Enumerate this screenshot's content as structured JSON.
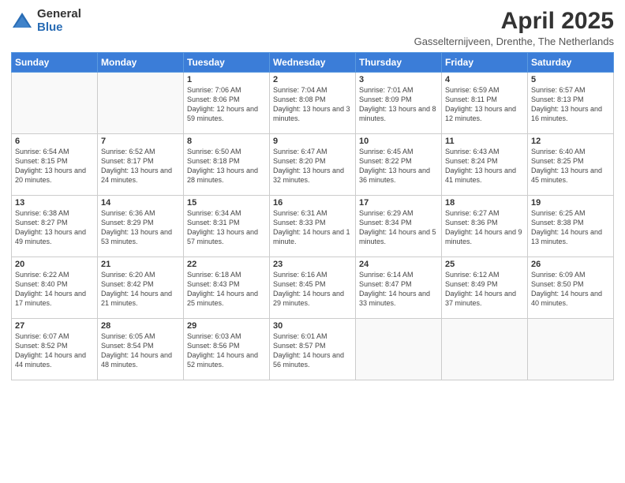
{
  "logo": {
    "general": "General",
    "blue": "Blue"
  },
  "header": {
    "title": "April 2025",
    "subtitle": "Gasselternijveen, Drenthe, The Netherlands"
  },
  "days_of_week": [
    "Sunday",
    "Monday",
    "Tuesday",
    "Wednesday",
    "Thursday",
    "Friday",
    "Saturday"
  ],
  "weeks": [
    [
      {
        "day": "",
        "info": ""
      },
      {
        "day": "",
        "info": ""
      },
      {
        "day": "1",
        "info": "Sunrise: 7:06 AM\nSunset: 8:06 PM\nDaylight: 12 hours and 59 minutes."
      },
      {
        "day": "2",
        "info": "Sunrise: 7:04 AM\nSunset: 8:08 PM\nDaylight: 13 hours and 3 minutes."
      },
      {
        "day": "3",
        "info": "Sunrise: 7:01 AM\nSunset: 8:09 PM\nDaylight: 13 hours and 8 minutes."
      },
      {
        "day": "4",
        "info": "Sunrise: 6:59 AM\nSunset: 8:11 PM\nDaylight: 13 hours and 12 minutes."
      },
      {
        "day": "5",
        "info": "Sunrise: 6:57 AM\nSunset: 8:13 PM\nDaylight: 13 hours and 16 minutes."
      }
    ],
    [
      {
        "day": "6",
        "info": "Sunrise: 6:54 AM\nSunset: 8:15 PM\nDaylight: 13 hours and 20 minutes."
      },
      {
        "day": "7",
        "info": "Sunrise: 6:52 AM\nSunset: 8:17 PM\nDaylight: 13 hours and 24 minutes."
      },
      {
        "day": "8",
        "info": "Sunrise: 6:50 AM\nSunset: 8:18 PM\nDaylight: 13 hours and 28 minutes."
      },
      {
        "day": "9",
        "info": "Sunrise: 6:47 AM\nSunset: 8:20 PM\nDaylight: 13 hours and 32 minutes."
      },
      {
        "day": "10",
        "info": "Sunrise: 6:45 AM\nSunset: 8:22 PM\nDaylight: 13 hours and 36 minutes."
      },
      {
        "day": "11",
        "info": "Sunrise: 6:43 AM\nSunset: 8:24 PM\nDaylight: 13 hours and 41 minutes."
      },
      {
        "day": "12",
        "info": "Sunrise: 6:40 AM\nSunset: 8:25 PM\nDaylight: 13 hours and 45 minutes."
      }
    ],
    [
      {
        "day": "13",
        "info": "Sunrise: 6:38 AM\nSunset: 8:27 PM\nDaylight: 13 hours and 49 minutes."
      },
      {
        "day": "14",
        "info": "Sunrise: 6:36 AM\nSunset: 8:29 PM\nDaylight: 13 hours and 53 minutes."
      },
      {
        "day": "15",
        "info": "Sunrise: 6:34 AM\nSunset: 8:31 PM\nDaylight: 13 hours and 57 minutes."
      },
      {
        "day": "16",
        "info": "Sunrise: 6:31 AM\nSunset: 8:33 PM\nDaylight: 14 hours and 1 minute."
      },
      {
        "day": "17",
        "info": "Sunrise: 6:29 AM\nSunset: 8:34 PM\nDaylight: 14 hours and 5 minutes."
      },
      {
        "day": "18",
        "info": "Sunrise: 6:27 AM\nSunset: 8:36 PM\nDaylight: 14 hours and 9 minutes."
      },
      {
        "day": "19",
        "info": "Sunrise: 6:25 AM\nSunset: 8:38 PM\nDaylight: 14 hours and 13 minutes."
      }
    ],
    [
      {
        "day": "20",
        "info": "Sunrise: 6:22 AM\nSunset: 8:40 PM\nDaylight: 14 hours and 17 minutes."
      },
      {
        "day": "21",
        "info": "Sunrise: 6:20 AM\nSunset: 8:42 PM\nDaylight: 14 hours and 21 minutes."
      },
      {
        "day": "22",
        "info": "Sunrise: 6:18 AM\nSunset: 8:43 PM\nDaylight: 14 hours and 25 minutes."
      },
      {
        "day": "23",
        "info": "Sunrise: 6:16 AM\nSunset: 8:45 PM\nDaylight: 14 hours and 29 minutes."
      },
      {
        "day": "24",
        "info": "Sunrise: 6:14 AM\nSunset: 8:47 PM\nDaylight: 14 hours and 33 minutes."
      },
      {
        "day": "25",
        "info": "Sunrise: 6:12 AM\nSunset: 8:49 PM\nDaylight: 14 hours and 37 minutes."
      },
      {
        "day": "26",
        "info": "Sunrise: 6:09 AM\nSunset: 8:50 PM\nDaylight: 14 hours and 40 minutes."
      }
    ],
    [
      {
        "day": "27",
        "info": "Sunrise: 6:07 AM\nSunset: 8:52 PM\nDaylight: 14 hours and 44 minutes."
      },
      {
        "day": "28",
        "info": "Sunrise: 6:05 AM\nSunset: 8:54 PM\nDaylight: 14 hours and 48 minutes."
      },
      {
        "day": "29",
        "info": "Sunrise: 6:03 AM\nSunset: 8:56 PM\nDaylight: 14 hours and 52 minutes."
      },
      {
        "day": "30",
        "info": "Sunrise: 6:01 AM\nSunset: 8:57 PM\nDaylight: 14 hours and 56 minutes."
      },
      {
        "day": "",
        "info": ""
      },
      {
        "day": "",
        "info": ""
      },
      {
        "day": "",
        "info": ""
      }
    ]
  ]
}
